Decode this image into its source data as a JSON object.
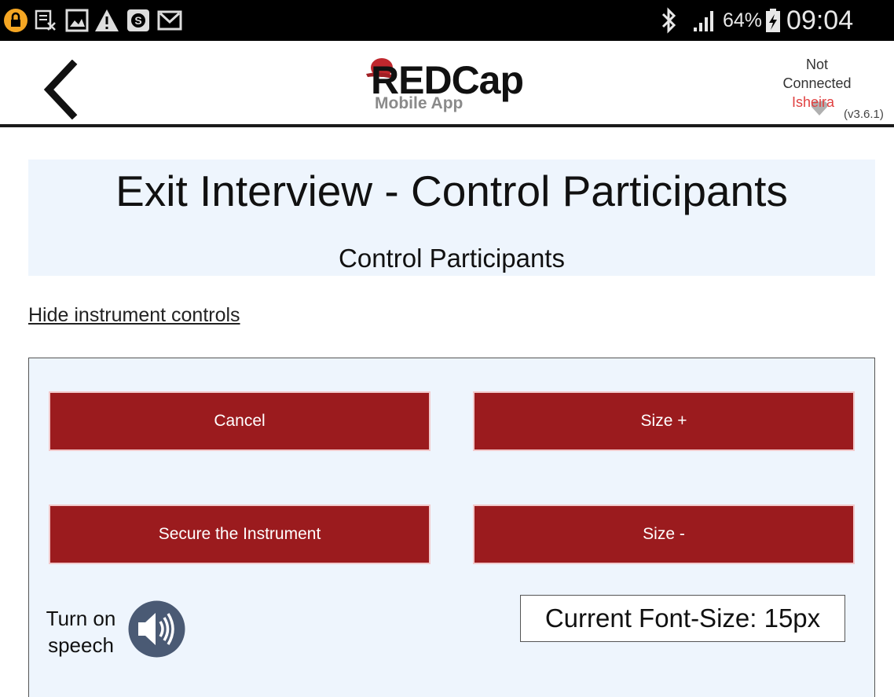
{
  "status_bar": {
    "icons": [
      "lock-icon",
      "notes-icon",
      "image-icon",
      "warning-icon",
      "shazam-icon",
      "gmail-icon"
    ],
    "battery_percent": "64%",
    "time": "09:04"
  },
  "header": {
    "logo_title": "REDCap",
    "logo_subtitle": "Mobile App",
    "connection_line1": "Not",
    "connection_line2": "Connected",
    "username": "Isheira",
    "version": "(v3.6.1)"
  },
  "form": {
    "title": "Exit Interview - Control Participants",
    "subtitle": "Control Participants"
  },
  "controls": {
    "hide_link": "Hide instrument controls",
    "cancel_label": "Cancel",
    "size_plus_label": "Size +",
    "secure_label": "Secure the Instrument",
    "size_minus_label": "Size -",
    "speech_label": "Turn on speech",
    "font_size_text": "Current Font-Size: 15px"
  },
  "colors": {
    "accent_button": "#9b1b1e",
    "panel_background": "#eef5fd"
  }
}
